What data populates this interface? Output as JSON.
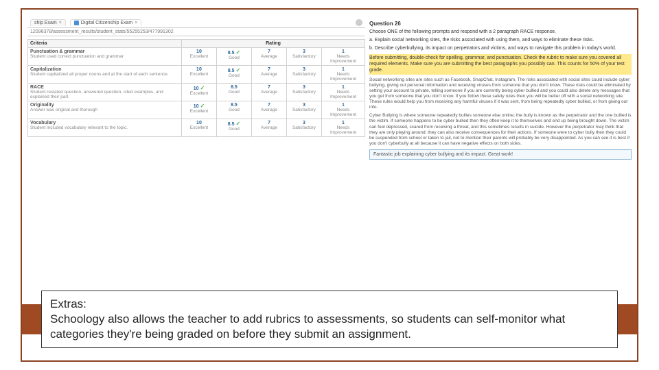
{
  "tabs": {
    "tab1_suffix": "ship Exam",
    "tab2": "Digital Citizenship Exam"
  },
  "address": "12096378/assessment_results/student_stats/55255253/477991302",
  "rubric": {
    "header": {
      "criteria": "Criteria",
      "rating": "Rating"
    },
    "cols": [
      {
        "score": "10",
        "label": "Excellent"
      },
      {
        "score": "8.5",
        "label": "Good"
      },
      {
        "score": "7",
        "label": "Average"
      },
      {
        "score": "3",
        "label": "Satisfactory"
      },
      {
        "score": "1",
        "label": "Needs Improvement"
      }
    ],
    "rows": [
      {
        "name": "Punctuation & grammar",
        "desc": "Student used correct punctuation and grammar",
        "checked": 1
      },
      {
        "name": "Capitalization",
        "desc": "Student capitalized all proper nouns and at the start of each sentence.",
        "checked": 1
      },
      {
        "name": "RACE",
        "desc": "Student restated question, answered question, cited examples, and explained their part.",
        "checked": 0
      },
      {
        "name": "Originality",
        "desc": "Answer was original and thorough",
        "checked": 0
      },
      {
        "name": "Vocabulary",
        "desc": "Student included vocabulary relevant to the topic.",
        "checked": 1
      }
    ]
  },
  "question": {
    "title": "Question 26",
    "prompt": "Choose ONE of the following prompts and respond with a 2 paragraph RACE response.",
    "opt_a": "a. Explain social networking sites, the risks associated with using them, and ways to eliminate these risks.",
    "opt_b": "b. Describe cyberbullying, its impact on perpetrators and victims, and ways to navigate this problem in today's world.",
    "hint": "Before submitting, double-check for spelling, grammar, and punctuation. Check the rubric to make sure you covered all required elements. Make sure you are submitting the best paragraphs you possibly can. This counts for 50% of your test grade.",
    "answer_p1": "Social networking sites are sites such as Facebook, SnapChat, Instagram. The risks associated with social sites could include cyber bullying, giving out personal information and receiving viruses from someone that you don't know. These risks could be eliminated by setting your account to private, telling someone if you are currently being cyber bullied and you could also delete any messages that you get from someone that you don't know. If you follow these safety rules then you will be better off with a social networking site. These rules would help you from receiving any harmful viruses if it was sent, from being repeatedly cyber bullied, or from giving out info.",
    "answer_p2": "Cyber Bullying is where someone repeatedly bullies someone else online; the bully is known as the perpetrator and the one bullied is the victim. If someone happens to be cyber bullied then they often keep it to themselves and end up being brought down. The victim can feel depressed, scared from receiving a threat, and this sometimes results in suicide. However the perpetrator may think that they are only playing around; they can also receive consequences for their actions. If someone were to cyber bully then they could be suspended from school or taken to jail, not to mention their parents will probably be very disappointed. As you can see it is best if you don't cyberbully at all because it can have negative effects on both sides.",
    "feedback": "Fantastic job explaining cyber bullying and its impact. Great work!"
  },
  "caption": {
    "label": "Extras:",
    "text": "Schoology also allows the teacher to add rubrics to assessments, so students can self-monitor what categories they're being graded on before they submit an assignment."
  }
}
